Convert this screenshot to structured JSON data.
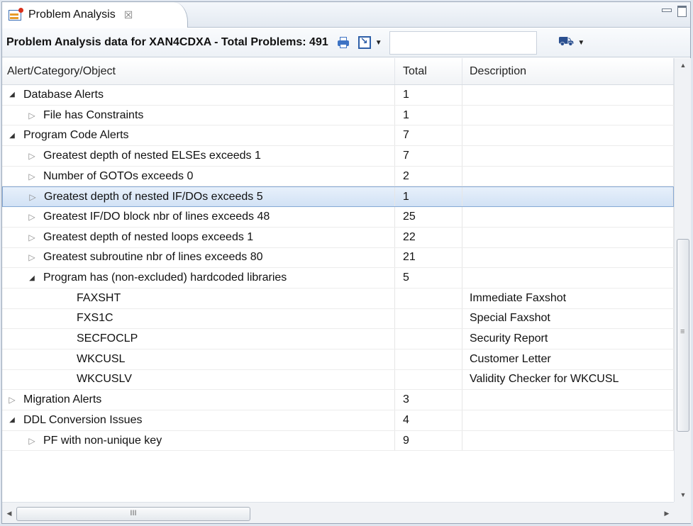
{
  "tab": {
    "label": "Problem Analysis",
    "close_glyph": "☒"
  },
  "toolbar": {
    "title": "Problem Analysis data for XAN4CDXA - Total Problems: 491",
    "search_value": "",
    "search_placeholder": ""
  },
  "table": {
    "columns": [
      "Alert/Category/Object",
      "Total",
      "Description"
    ],
    "rows": [
      {
        "level": 1,
        "state": "expanded",
        "label": "Database Alerts",
        "total": "1",
        "description": ""
      },
      {
        "level": 2,
        "state": "collapsed",
        "label": "File has Constraints",
        "total": "1",
        "description": ""
      },
      {
        "level": 1,
        "state": "expanded",
        "label": "Program Code Alerts",
        "total": "7",
        "description": ""
      },
      {
        "level": 2,
        "state": "collapsed",
        "label": "Greatest depth of nested ELSEs exceeds 1",
        "total": "7",
        "description": ""
      },
      {
        "level": 2,
        "state": "collapsed",
        "label": "Number of GOTOs exceeds 0",
        "total": "2",
        "description": ""
      },
      {
        "level": 2,
        "state": "collapsed",
        "label": "Greatest depth of nested IF/DOs exceeds 5",
        "total": "1",
        "description": "",
        "selected": true
      },
      {
        "level": 2,
        "state": "collapsed",
        "label": "Greatest IF/DO block nbr of lines exceeds 48",
        "total": "25",
        "description": ""
      },
      {
        "level": 2,
        "state": "collapsed",
        "label": "Greatest depth of nested loops exceeds 1",
        "total": "22",
        "description": ""
      },
      {
        "level": 2,
        "state": "collapsed",
        "label": "Greatest subroutine nbr of lines exceeds 80",
        "total": "21",
        "description": ""
      },
      {
        "level": 2,
        "state": "expanded",
        "label": "Program has (non-excluded) hardcoded libraries",
        "total": "5",
        "description": ""
      },
      {
        "level": 3,
        "state": "leaf",
        "label": "FAXSHT",
        "total": "",
        "description": "Immediate Faxshot"
      },
      {
        "level": 3,
        "state": "leaf",
        "label": "FXS1C",
        "total": "",
        "description": "Special Faxshot"
      },
      {
        "level": 3,
        "state": "leaf",
        "label": "SECFOCLP",
        "total": "",
        "description": "Security Report"
      },
      {
        "level": 3,
        "state": "leaf",
        "label": "WKCUSL",
        "total": "",
        "description": "Customer Letter"
      },
      {
        "level": 3,
        "state": "leaf",
        "label": "WKCUSLV",
        "total": "",
        "description": "Validity Checker for WKCUSL"
      },
      {
        "level": 1,
        "state": "collapsed",
        "label": "Migration Alerts",
        "total": "3",
        "description": ""
      },
      {
        "level": 1,
        "state": "expanded",
        "label": "DDL Conversion Issues",
        "total": "4",
        "description": ""
      },
      {
        "level": 2,
        "state": "collapsed",
        "label": "PF with non-unique key",
        "total": "9",
        "description": ""
      }
    ]
  },
  "scrollbar": {
    "grip_glyph": "≡",
    "hgrip_glyph": "III"
  },
  "colors": {
    "selection": "#d2e2f5",
    "selection_border": "#86a9d6",
    "accent": "#3d73c4"
  }
}
